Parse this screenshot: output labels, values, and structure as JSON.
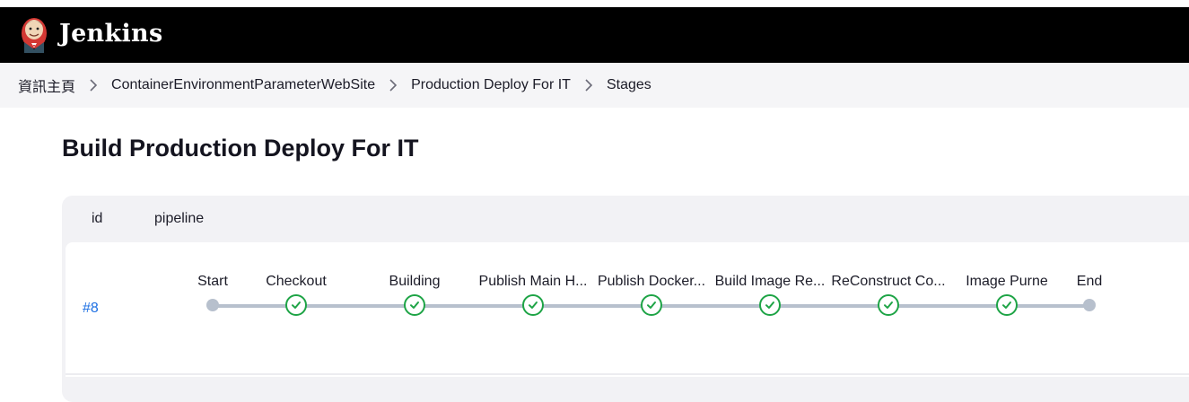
{
  "header": {
    "brand": "Jenkins",
    "logo_icon": "jenkins-butler-icon",
    "background": "#000000"
  },
  "breadcrumb": {
    "items": [
      "資訊主頁",
      "ContainerEnvironmentParameterWebSite",
      "Production Deploy For IT",
      "Stages"
    ]
  },
  "page": {
    "title": "Build Production Deploy For IT"
  },
  "table": {
    "columns": [
      "id",
      "pipeline"
    ],
    "rows": [
      {
        "id": "#8",
        "stages": [
          {
            "label": "Start",
            "status": "start"
          },
          {
            "label": "Checkout",
            "status": "success"
          },
          {
            "label": "Building",
            "status": "success"
          },
          {
            "label": "Publish Main H...",
            "status": "success"
          },
          {
            "label": "Publish Docker...",
            "status": "success"
          },
          {
            "label": "Build Image Re...",
            "status": "success"
          },
          {
            "label": "ReConstruct Co...",
            "status": "success"
          },
          {
            "label": "Image Purne",
            "status": "success"
          },
          {
            "label": "End",
            "status": "end"
          }
        ]
      }
    ]
  },
  "colors": {
    "success": "#1ea446",
    "track": "#b7c0cd",
    "link": "#1c6fe3"
  }
}
